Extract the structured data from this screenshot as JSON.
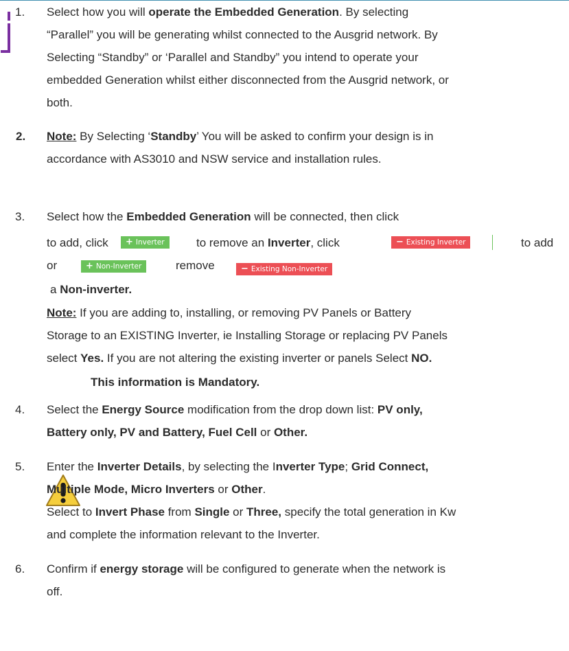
{
  "items": [
    {
      "number": "1.",
      "lines": [
        [
          {
            "t": "Select how you will "
          },
          {
            "t": "operate the Embedded Generation",
            "b": true
          },
          {
            "t": ". By selecting"
          }
        ],
        [
          {
            "t": "“Parallel” you will be generating whilst connected to the Ausgrid network. By"
          }
        ],
        [
          {
            "t": "Selecting “Standby” or ‘Parallel and Standby” you intend to operate your"
          }
        ],
        [
          {
            "t": "embedded Generation whilst either disconnected from the Ausgrid network, or"
          }
        ],
        [
          {
            "t": "both."
          }
        ]
      ]
    },
    {
      "number": "2.",
      "lines": [
        [
          {
            "t": "Note:",
            "b": true,
            "u": true
          },
          {
            "t": " By Selecting ‘"
          },
          {
            "t": "Standby",
            "b": true
          },
          {
            "t": "’ You will be asked to confirm your design is in"
          }
        ],
        [
          {
            "t": "accordance with AS3010 and NSW service and installation rules."
          }
        ]
      ]
    },
    {
      "number": "3.",
      "lines": [
        [
          {
            "t": "Select how the "
          },
          {
            "t": "Embedded Generation",
            "b": true
          },
          {
            "t": " will be connected, then click"
          }
        ]
      ],
      "row2": {
        "a": "to add, click",
        "b": "to remove an ",
        "c": "Inverter",
        "d": ", click",
        "e": "to add"
      },
      "row3": {
        "a": "or",
        "b": "remove"
      },
      "row4": [
        {
          "t": "a "
        },
        {
          "t": "Non-inverter.",
          "b": true
        }
      ],
      "note_lines": [
        [
          {
            "t": "Note:",
            "b": true,
            "u": true
          },
          {
            "t": " If you are adding to, installing, or removing  PV Panels or Battery"
          }
        ],
        [
          {
            "t": "Storage to an  EXISTING Inverter, ie Installing Storage or replacing  PV Panels"
          }
        ],
        [
          {
            "t": "select "
          },
          {
            "t": "Yes.",
            "b": true
          },
          {
            "t": " If you are not altering the existing inverter or panels Select "
          },
          {
            "t": "NO.",
            "b": true
          }
        ]
      ],
      "warning": "This information is Mandatory."
    },
    {
      "number": "4.",
      "lines": [
        [
          {
            "t": "Select the "
          },
          {
            "t": "Energy Source",
            "b": true
          },
          {
            "t": " modification from the drop down list: "
          },
          {
            "t": "PV only,",
            "b": true
          }
        ],
        [
          {
            "t": "Battery only, PV and Battery, Fuel Cell",
            "b": true
          },
          {
            "t": " or "
          },
          {
            "t": "Other.",
            "b": true
          }
        ]
      ]
    },
    {
      "number": "5.",
      "lines": [
        [
          {
            "t": "Enter the "
          },
          {
            "t": "Inverter Details",
            "b": true
          },
          {
            "t": ", by selecting the I"
          },
          {
            "t": "nverter Type",
            "b": true
          },
          {
            "t": "; "
          },
          {
            "t": "Grid Connect,",
            "b": true
          }
        ],
        [
          {
            "t": "Multiple Mode, Micro Inverters",
            "b": true
          },
          {
            "t": " or "
          },
          {
            "t": "Other",
            "b": true
          },
          {
            "t": "."
          }
        ],
        [
          {
            "t": "Select to "
          },
          {
            "t": "Invert Phase",
            "b": true
          },
          {
            "t": " from "
          },
          {
            "t": "Single",
            "b": true
          },
          {
            "t": " or "
          },
          {
            "t": "Three,",
            "b": true
          },
          {
            "t": " specify the total generation in Kw"
          }
        ],
        [
          {
            "t": "and complete the information relevant to the Inverter."
          }
        ]
      ]
    },
    {
      "number": "6.",
      "lines": [
        [
          {
            "t": "Confirm if "
          },
          {
            "t": "energy storage",
            "b": true
          },
          {
            "t": " will be configured to generate when the network is"
          }
        ],
        [
          {
            "t": "off."
          }
        ]
      ]
    }
  ],
  "buttons": {
    "add_inverter": "Inverter",
    "existing_inverter": "Existing Inverter",
    "add_non_inverter": "Non-Inverter",
    "existing_non_inverter": "Existing Non-Inverter",
    "plus_symbol": "+",
    "minus_symbol": "−"
  },
  "colors": {
    "add": "#6ac25a",
    "remove": "#ec4f55",
    "accent": "#7a2fa0"
  }
}
